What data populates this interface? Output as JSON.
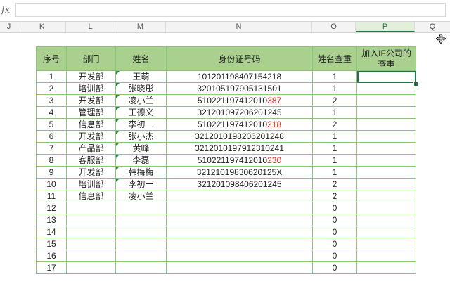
{
  "formula_bar": {
    "fx_label": "fx",
    "value": ""
  },
  "columns": [
    {
      "label": "J"
    },
    {
      "label": "K"
    },
    {
      "label": "L"
    },
    {
      "label": "M"
    },
    {
      "label": "N"
    },
    {
      "label": "O"
    },
    {
      "label": "P",
      "selected": true
    },
    {
      "label": "Q"
    }
  ],
  "table": {
    "headers": [
      "序号",
      "部门",
      "姓名",
      "身份证号码",
      "姓名查重",
      "加入IF公司的查重"
    ],
    "rows": [
      {
        "no": "1",
        "dept": "开发部",
        "name": "王萌",
        "id_main": "101201198407154218",
        "id_red": "",
        "dup": "1",
        "ifdup": ""
      },
      {
        "no": "2",
        "dept": "培训部",
        "name": "张晓彤",
        "id_main": "320105197905131501",
        "id_red": "",
        "dup": "1",
        "ifdup": ""
      },
      {
        "no": "3",
        "dept": "开发部",
        "name": "凌小兰",
        "id_main": "510221197412010",
        "id_red": "387",
        "dup": "2",
        "ifdup": ""
      },
      {
        "no": "4",
        "dept": "管理部",
        "name": "王德义",
        "id_main": "321201097206201245",
        "id_red": "",
        "dup": "1",
        "ifdup": ""
      },
      {
        "no": "5",
        "dept": "信息部",
        "name": "李初一",
        "id_main": "510221197412010",
        "id_red": "218",
        "dup": "2",
        "ifdup": ""
      },
      {
        "no": "6",
        "dept": "开发部",
        "name": "张小杰",
        "id_main": "321201019820620124 8",
        "id_red": "",
        "dup": "1",
        "ifdup": ""
      },
      {
        "no": "7",
        "dept": "产品部",
        "name": "黄峰",
        "id_main": "321201019791231024 1",
        "id_red": "",
        "dup": "1",
        "ifdup": ""
      },
      {
        "no": "8",
        "dept": "客服部",
        "name": "李磊",
        "id_main": "510221197412010",
        "id_red": "230",
        "dup": "1",
        "ifdup": ""
      },
      {
        "no": "9",
        "dept": "开发部",
        "name": "韩梅梅",
        "id_main": "32121019830620125X",
        "id_red": "",
        "dup": "1",
        "ifdup": ""
      },
      {
        "no": "10",
        "dept": "培训部",
        "name": "李初一",
        "id_main": "321201098406201245",
        "id_red": "",
        "dup": "2",
        "ifdup": ""
      },
      {
        "no": "11",
        "dept": "信息部",
        "name": "凌小兰",
        "id_main": "",
        "id_red": "",
        "dup": "2",
        "ifdup": ""
      },
      {
        "no": "12",
        "dept": "",
        "name": "",
        "id_main": "",
        "id_red": "",
        "dup": "0",
        "ifdup": ""
      },
      {
        "no": "13",
        "dept": "",
        "name": "",
        "id_main": "",
        "id_red": "",
        "dup": "0",
        "ifdup": ""
      },
      {
        "no": "14",
        "dept": "",
        "name": "",
        "id_main": "",
        "id_red": "",
        "dup": "0",
        "ifdup": ""
      },
      {
        "no": "15",
        "dept": "",
        "name": "",
        "id_main": "",
        "id_red": "",
        "dup": "0",
        "ifdup": ""
      },
      {
        "no": "16",
        "dept": "",
        "name": "",
        "id_main": "",
        "id_red": "",
        "dup": "0",
        "ifdup": ""
      },
      {
        "no": "17",
        "dept": "",
        "name": "",
        "id_main": "",
        "id_red": "",
        "dup": "0",
        "ifdup": ""
      }
    ]
  },
  "colors": {
    "header_fill": "#a9d08e",
    "border": "#8fc57a",
    "highlight": "#e02a1f",
    "selection": "#217346"
  }
}
